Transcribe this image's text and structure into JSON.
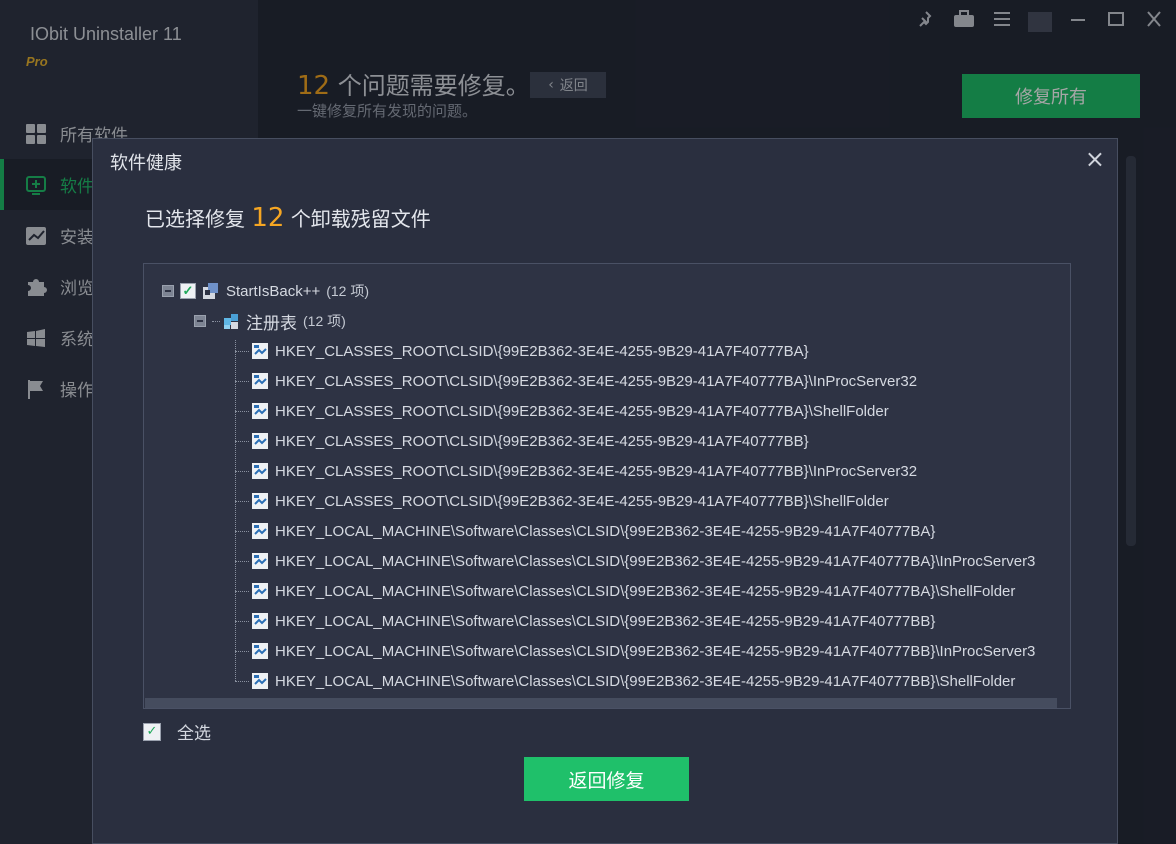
{
  "app": {
    "title": "IObit Uninstaller 11",
    "edition": "Pro",
    "nav": [
      {
        "label": "所有软件",
        "icon": "grid-icon"
      },
      {
        "label": "软件",
        "icon": "software-health-icon",
        "active": true
      },
      {
        "label": "安装",
        "icon": "chart-icon"
      },
      {
        "label": "浏览",
        "icon": "puzzle-icon"
      },
      {
        "label": "系统",
        "icon": "windows-icon"
      },
      {
        "label": "操作",
        "icon": "flag-icon"
      }
    ],
    "toolbar_icons": [
      "pin-icon",
      "briefcase-icon",
      "menu-icon",
      "minimize-icon",
      "maximize-icon",
      "close-icon"
    ]
  },
  "main": {
    "issue_count": "12",
    "issue_text": "个问题需要修复。",
    "back_label": "返回",
    "subtitle": "一键修复所有发现的问题。",
    "fix_all_label": "修复所有"
  },
  "dialog": {
    "title": "软件健康",
    "close_symbol": "×",
    "heading_prefix": "已选择修复",
    "heading_count": "12",
    "heading_suffix": "个卸载残留文件",
    "root": {
      "label": "StartIsBack++",
      "count": "(12 项)"
    },
    "group": {
      "label": "注册表",
      "count": "(12 项)"
    },
    "items": [
      "HKEY_CLASSES_ROOT\\CLSID\\{99E2B362-3E4E-4255-9B29-41A7F40777BA}",
      "HKEY_CLASSES_ROOT\\CLSID\\{99E2B362-3E4E-4255-9B29-41A7F40777BA}\\InProcServer32",
      "HKEY_CLASSES_ROOT\\CLSID\\{99E2B362-3E4E-4255-9B29-41A7F40777BA}\\ShellFolder",
      "HKEY_CLASSES_ROOT\\CLSID\\{99E2B362-3E4E-4255-9B29-41A7F40777BB}",
      "HKEY_CLASSES_ROOT\\CLSID\\{99E2B362-3E4E-4255-9B29-41A7F40777BB}\\InProcServer32",
      "HKEY_CLASSES_ROOT\\CLSID\\{99E2B362-3E4E-4255-9B29-41A7F40777BB}\\ShellFolder",
      "HKEY_LOCAL_MACHINE\\Software\\Classes\\CLSID\\{99E2B362-3E4E-4255-9B29-41A7F40777BA}",
      "HKEY_LOCAL_MACHINE\\Software\\Classes\\CLSID\\{99E2B362-3E4E-4255-9B29-41A7F40777BA}\\InProcServer3",
      "HKEY_LOCAL_MACHINE\\Software\\Classes\\CLSID\\{99E2B362-3E4E-4255-9B29-41A7F40777BA}\\ShellFolder",
      "HKEY_LOCAL_MACHINE\\Software\\Classes\\CLSID\\{99E2B362-3E4E-4255-9B29-41A7F40777BB}",
      "HKEY_LOCAL_MACHINE\\Software\\Classes\\CLSID\\{99E2B362-3E4E-4255-9B29-41A7F40777BB}\\InProcServer3",
      "HKEY_LOCAL_MACHINE\\Software\\Classes\\CLSID\\{99E2B362-3E4E-4255-9B29-41A7F40777BB}\\ShellFolder"
    ],
    "select_all_label": "全选",
    "back_button_label": "返回修复"
  },
  "colors": {
    "accent_green": "#1fc06a",
    "highlight_orange": "#f5a623",
    "dialog_bg": "#2a2f3f",
    "sidebar_bg": "#303647"
  }
}
